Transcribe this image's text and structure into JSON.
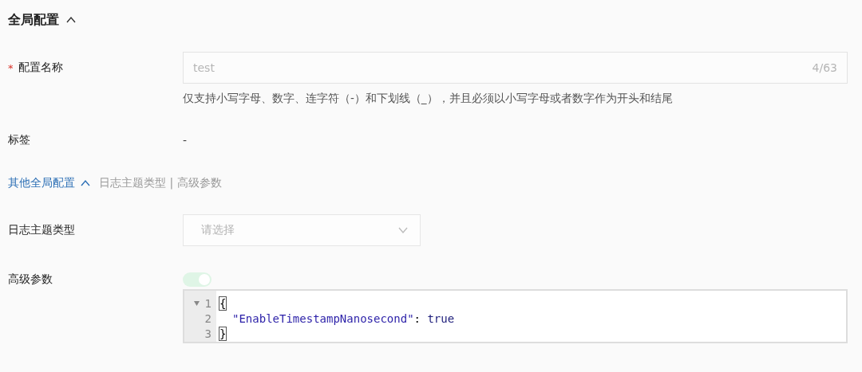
{
  "section": {
    "title": "全局配置",
    "expanded": true
  },
  "fields": [
    {
      "kind": "input",
      "label": "配置名称",
      "required": true,
      "required_mark": "*",
      "value": "test",
      "counter": "4/63",
      "hint": "仅支持小写字母、数字、连字符（-）和下划线（_），并且必须以小写字母或者数字作为开头和结尾"
    },
    {
      "kind": "text",
      "label": "标签",
      "required": false,
      "value": "-"
    }
  ],
  "subsection": {
    "title": "其他全局配置",
    "expanded": true,
    "summary": "日志主题类型 | 高级参数"
  },
  "subfields": [
    {
      "kind": "select",
      "label": "日志主题类型",
      "placeholder": "请选择"
    },
    {
      "kind": "editor",
      "label": "高级参数",
      "switch": {
        "on": true,
        "disabled": true
      },
      "lines": [
        {
          "number": "1",
          "foldable": true,
          "indented": false,
          "tokens": [
            {
              "kind": "bracket",
              "text": "{"
            }
          ]
        },
        {
          "number": "2",
          "foldable": false,
          "indented": true,
          "tokens": [
            {
              "kind": "key",
              "text": "\"EnableTimestampNanosecond\""
            },
            {
              "kind": "punct",
              "text": ": "
            },
            {
              "kind": "boolean",
              "text": "true"
            }
          ]
        },
        {
          "number": "3",
          "foldable": false,
          "indented": false,
          "tokens": [
            {
              "kind": "bracket",
              "text": "}"
            }
          ]
        }
      ]
    }
  ]
}
